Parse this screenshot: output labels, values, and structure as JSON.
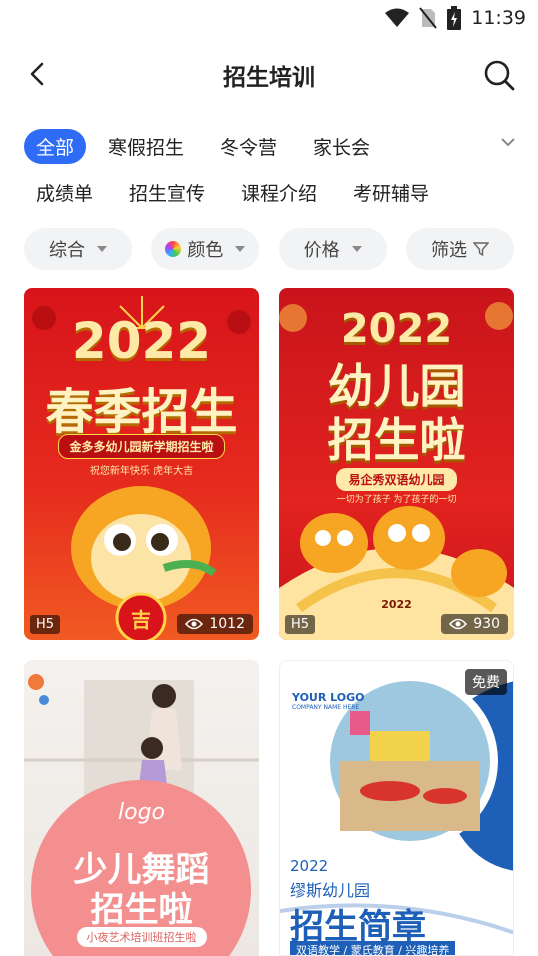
{
  "status": {
    "time": "11:39"
  },
  "header": {
    "title": "招生培训"
  },
  "categories": {
    "row1": [
      "全部",
      "寒假招生",
      "冬令营",
      "家长会"
    ],
    "row2": [
      "成绩单",
      "招生宣传",
      "课程介绍",
      "考研辅导"
    ]
  },
  "filters": {
    "sort": "综合",
    "color": "颜色",
    "price": "价格",
    "screen": "筛选"
  },
  "cards": [
    {
      "year": "2022",
      "title": "春季招生",
      "subtitle": "金多多幼儿园新学期招生啦",
      "line": "祝您新年快乐 虎年大吉",
      "badge": "吉",
      "tag": "H5",
      "views": "1012"
    },
    {
      "year": "2022",
      "title1": "幼儿园",
      "title2": "招生啦",
      "subtitle": "易企秀双语幼儿园",
      "line": "一切为了孩子 为了孩子的一切",
      "small_year": "2022",
      "tag": "H5",
      "views": "930"
    },
    {
      "logo": "logo",
      "title1": "少儿舞蹈",
      "title2": "招生啦",
      "subtitle": "小夜艺术培训班招生啦"
    },
    {
      "free": "免费",
      "logo": "YOUR LOGO",
      "logo_sub": "COMPANY NAME HERE",
      "year": "2022",
      "school": "缪斯幼儿园",
      "title": "招生简章",
      "band": "双语教学 / 蒙氏教育 / 兴趣培养"
    }
  ]
}
